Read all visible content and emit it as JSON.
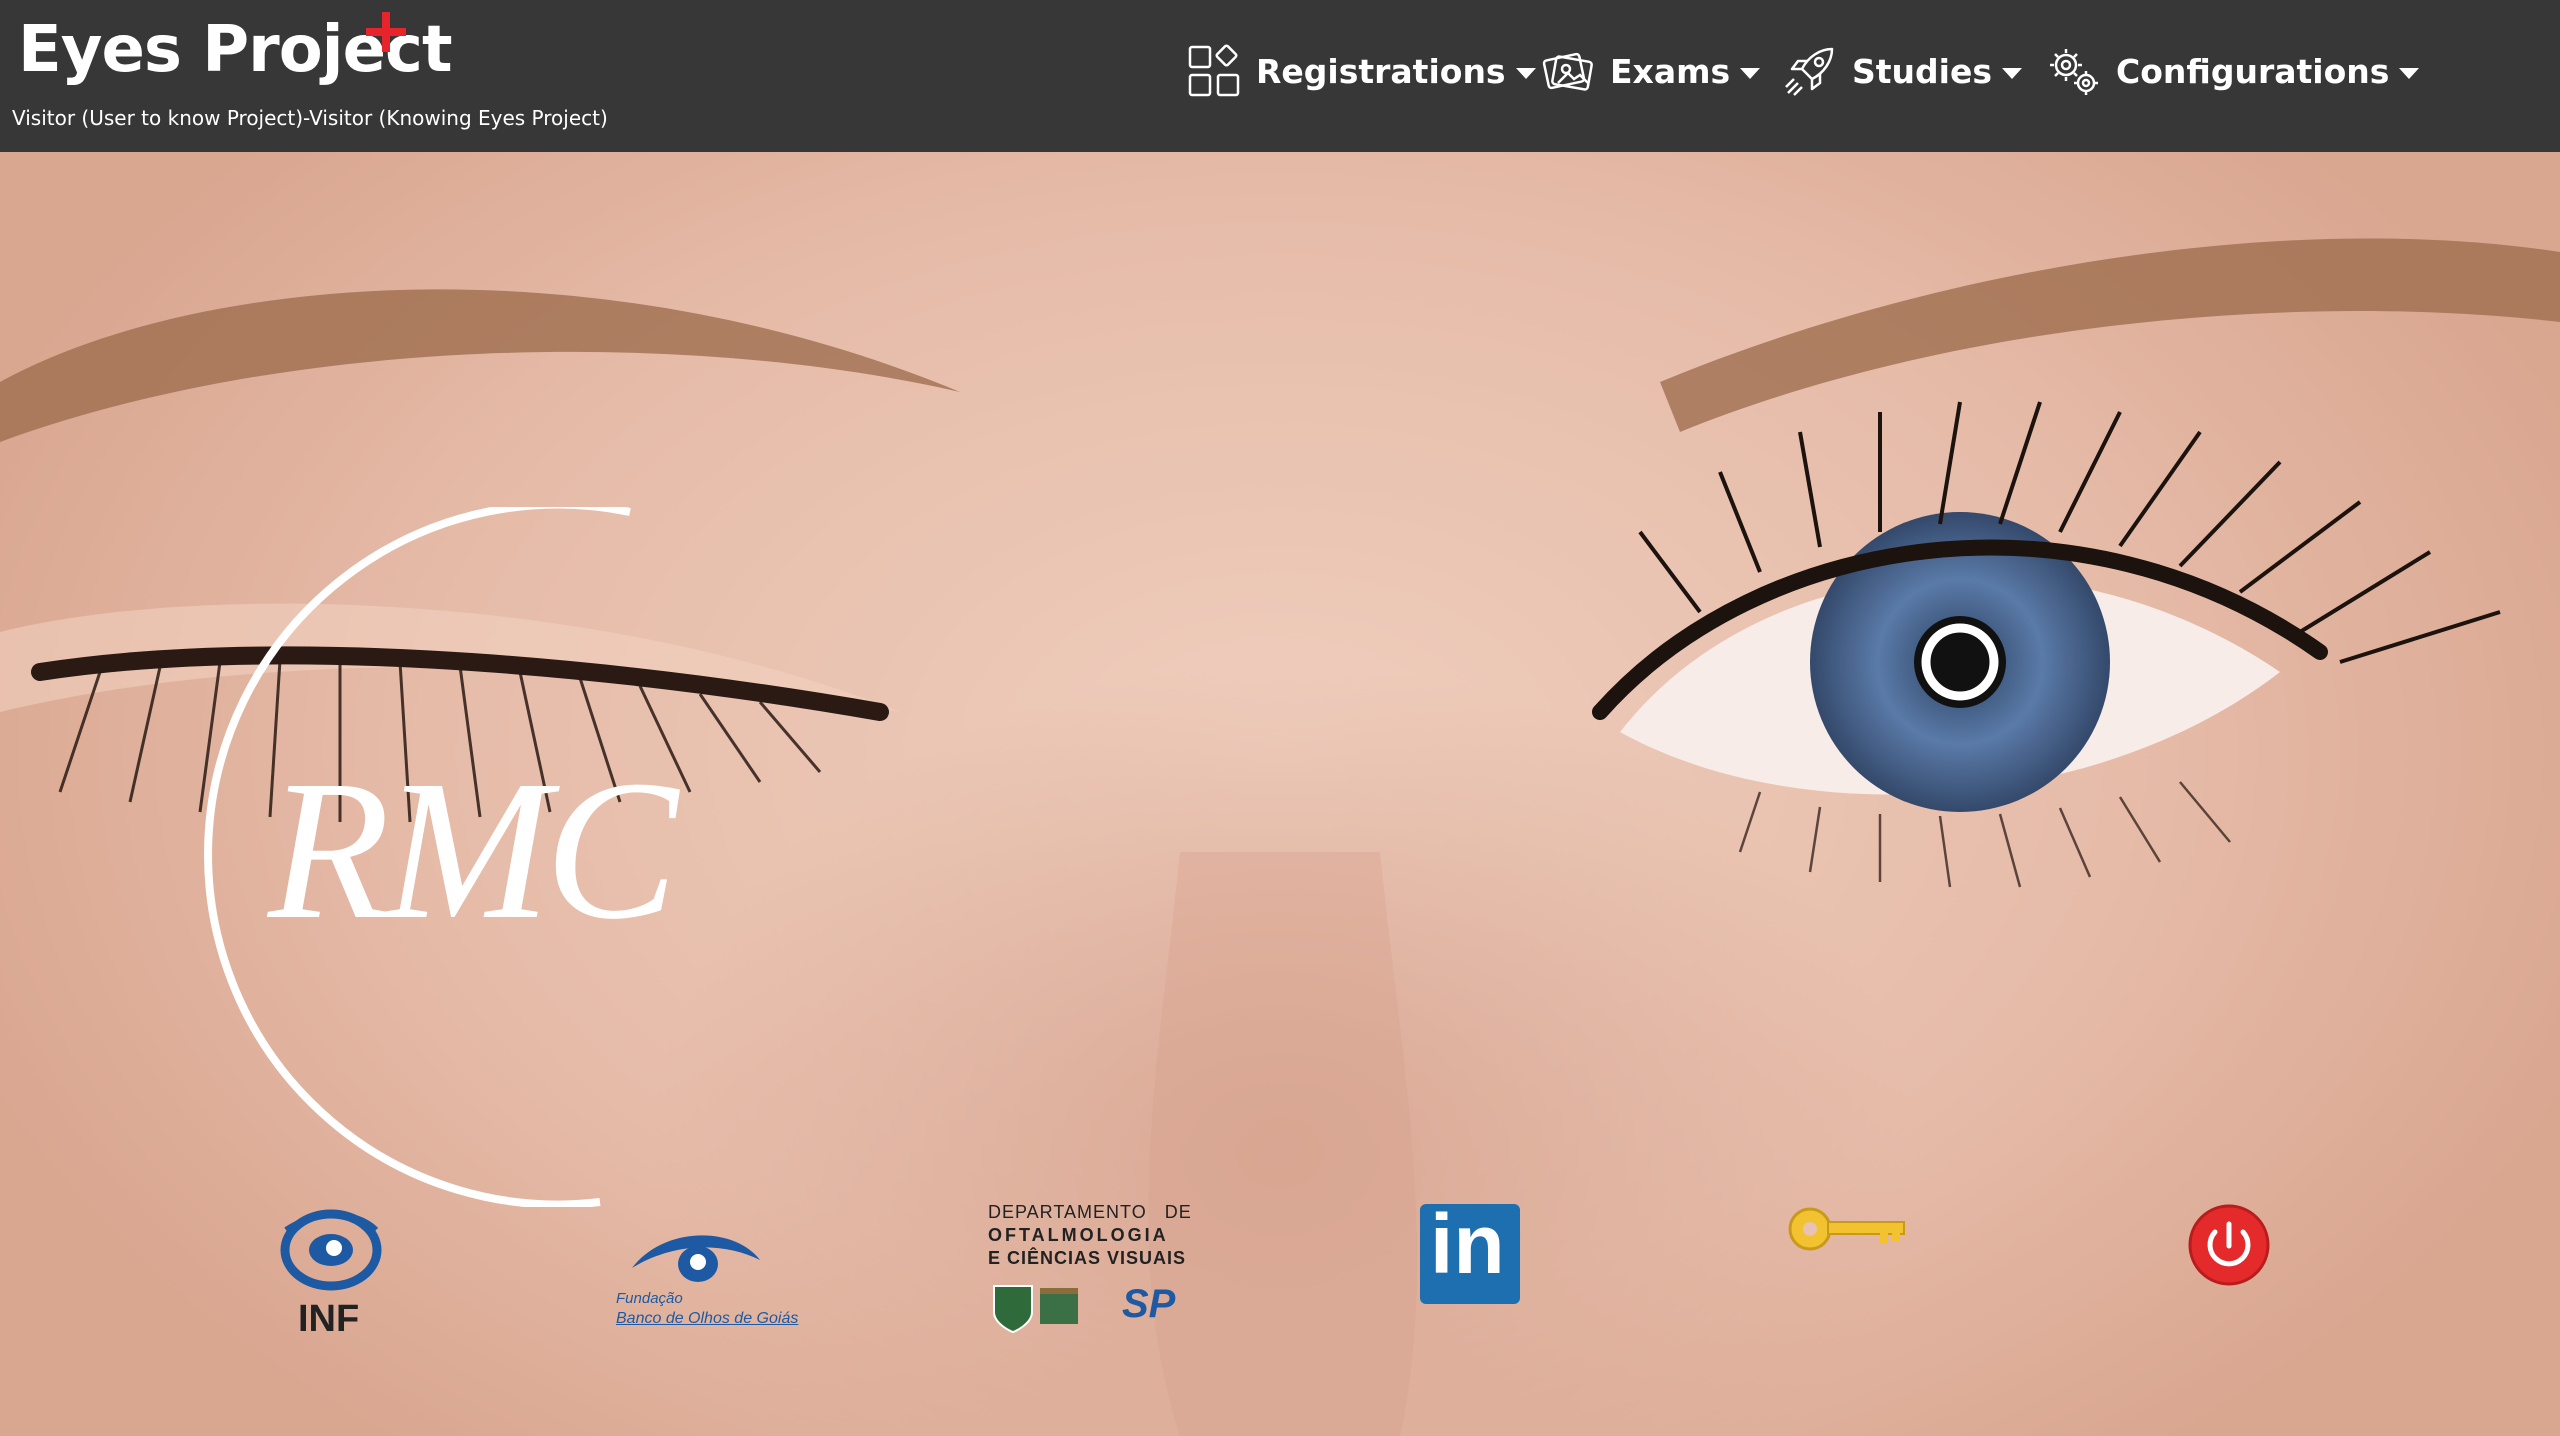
{
  "app": {
    "title": "Eyes Project",
    "subtitle": "Visitor (User to know Project)-Visitor (Knowing Eyes Project)"
  },
  "nav": {
    "items": [
      {
        "label": "Registrations",
        "icon": "grid-shapes-icon"
      },
      {
        "label": "Exams",
        "icon": "photos-icon"
      },
      {
        "label": "Studies",
        "icon": "rocket-icon"
      },
      {
        "label": "Configurations",
        "icon": "gears-icon"
      }
    ]
  },
  "hero": {
    "logo_text": "RMC"
  },
  "footer": {
    "links": [
      {
        "name": "INF",
        "label": "INF"
      },
      {
        "name": "fundacao-banco-de-olhos",
        "label_line1": "Fundação",
        "label_line2": "Banco de Olhos de Goiás"
      },
      {
        "name": "departamento-oftalmologia",
        "line1": "DEPARTAMENTO   DE",
        "line2": "OFTALMOLOGIA",
        "line3": "E CIÊNCIAS VISUAIS",
        "badge": "SP"
      },
      {
        "name": "linkedin",
        "label": "in"
      },
      {
        "name": "key",
        "icon": "key-icon"
      },
      {
        "name": "power",
        "icon": "power-icon"
      }
    ]
  },
  "colors": {
    "header_bg": "#373737",
    "plus_red": "#e8242b",
    "linkedin_blue": "#1d6fb0",
    "power_red": "#e42a2a",
    "key_gold": "#f2c230",
    "eye_blue": "#5a7aa8"
  }
}
